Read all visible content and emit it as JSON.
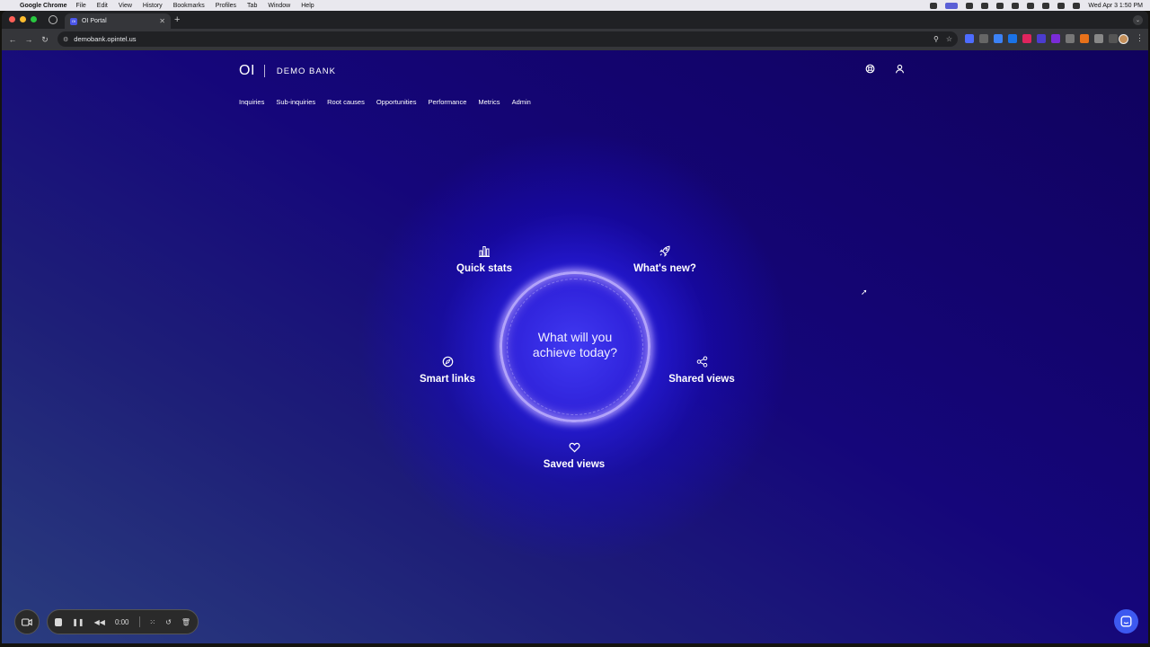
{
  "menubar": {
    "app": "Google Chrome",
    "items": [
      "File",
      "Edit",
      "View",
      "History",
      "Bookmarks",
      "Profiles",
      "Tab",
      "Window",
      "Help"
    ],
    "clock": "Wed Apr 3  1:50 PM"
  },
  "browser": {
    "tab_title": "OI Portal",
    "favicon": "OI",
    "url": "demobank.opintel.us"
  },
  "header": {
    "logo": "OI",
    "bank_name": "DEMO BANK",
    "icons": [
      "help-ring-icon",
      "user-icon"
    ]
  },
  "nav": [
    "Inquiries",
    "Sub-inquiries",
    "Root causes",
    "Opportunities",
    "Performance",
    "Metrics",
    "Admin"
  ],
  "hub": {
    "center_line1": "What will you",
    "center_line2": "achieve today?",
    "quick_stats": "Quick stats",
    "whats_new": "What's new?",
    "smart_links": "Smart links",
    "shared_views": "Shared views",
    "saved_views": "Saved views"
  },
  "recorder": {
    "time": "0:00"
  },
  "colors": {
    "accent": "#3d59f0",
    "page_top": "#10025e",
    "glow": "#4646ff"
  }
}
